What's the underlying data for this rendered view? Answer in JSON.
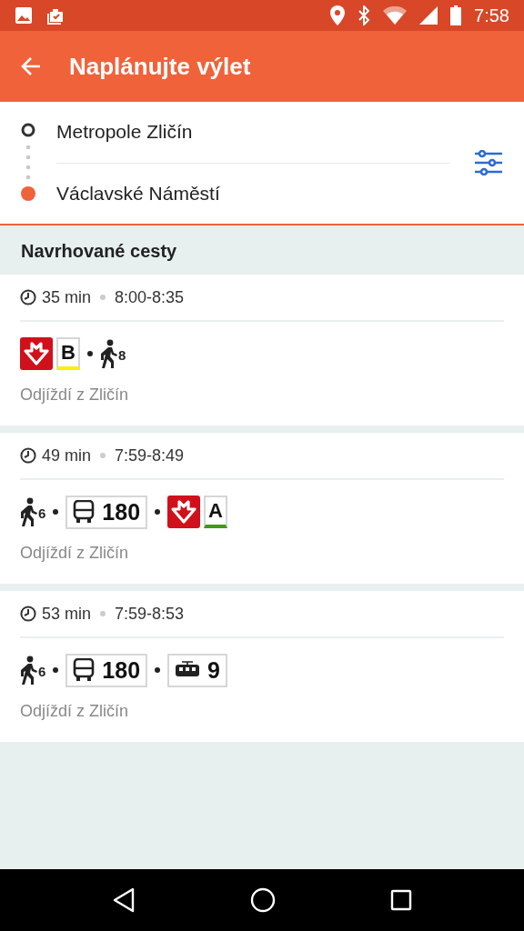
{
  "status_bar": {
    "time": "7:58"
  },
  "app_bar": {
    "title": "Naplánujte výlet"
  },
  "route": {
    "origin": "Metropole Zličín",
    "destination": "Václavské Náměstí"
  },
  "section": {
    "title": "Navrhované cesty"
  },
  "trips": [
    {
      "duration": "35 min",
      "time_range": "8:00-8:35",
      "legs": [
        {
          "kind": "metro",
          "line": "B",
          "color": "#ffee00"
        },
        {
          "kind": "walk",
          "minutes": "8"
        }
      ],
      "departure": "Odjíždí z Zličín"
    },
    {
      "duration": "49 min",
      "time_range": "7:59-8:49",
      "legs": [
        {
          "kind": "walk",
          "minutes": "6"
        },
        {
          "kind": "bus",
          "line": "180"
        },
        {
          "kind": "metro",
          "line": "A",
          "color": "#3f9a14"
        }
      ],
      "departure": "Odjíždí z Zličín"
    },
    {
      "duration": "53 min",
      "time_range": "7:59-8:53",
      "legs": [
        {
          "kind": "walk",
          "minutes": "6"
        },
        {
          "kind": "bus",
          "line": "180"
        },
        {
          "kind": "tram",
          "line": "9"
        }
      ],
      "departure": "Odjíždí z Zličín"
    }
  ]
}
